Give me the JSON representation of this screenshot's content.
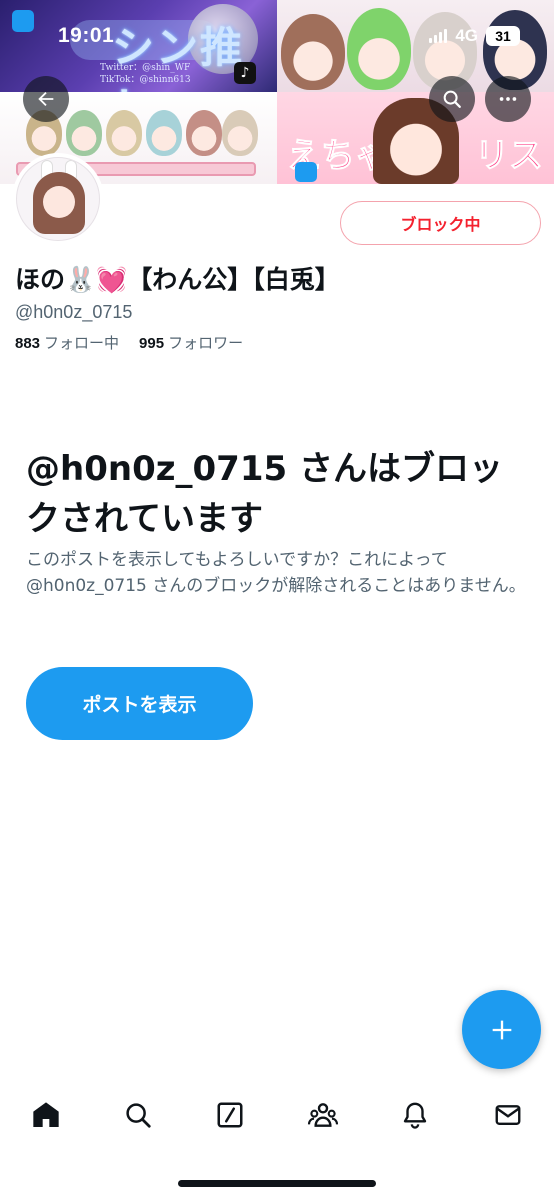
{
  "status_bar": {
    "time": "19:01",
    "network": "4G",
    "battery": "31"
  },
  "banner": {
    "title": "シン推し",
    "credit_line1": "Twitter：@shin_WF",
    "credit_line2": "TikTok：@shinn613",
    "text_left": "えちゃ",
    "text_right": "リス"
  },
  "profile": {
    "block_button_label": "ブロック中",
    "display_name": "ほの🐰💓【わん公】【白兎】",
    "handle": "@h0n0z_0715",
    "following_count": "883",
    "following_label": "フォロー中",
    "followers_count": "995",
    "followers_label": "フォロワー"
  },
  "blocked_notice": {
    "title": "@h0n0z_0715 さんはブロックされています",
    "description": "このポストを表示してもよろしいですか？これによって@h0n0z_0715 さんのブロックが解除されることはありません。",
    "button_label": "ポストを表示"
  },
  "colors": {
    "accent": "#1d9bf0",
    "danger": "#f4212e",
    "text_primary": "#0f1419",
    "text_secondary": "#536471"
  },
  "bottom_nav": {
    "items": [
      "home-icon",
      "search-icon",
      "compose-icon",
      "communities-icon",
      "notifications-icon",
      "messages-icon"
    ]
  }
}
